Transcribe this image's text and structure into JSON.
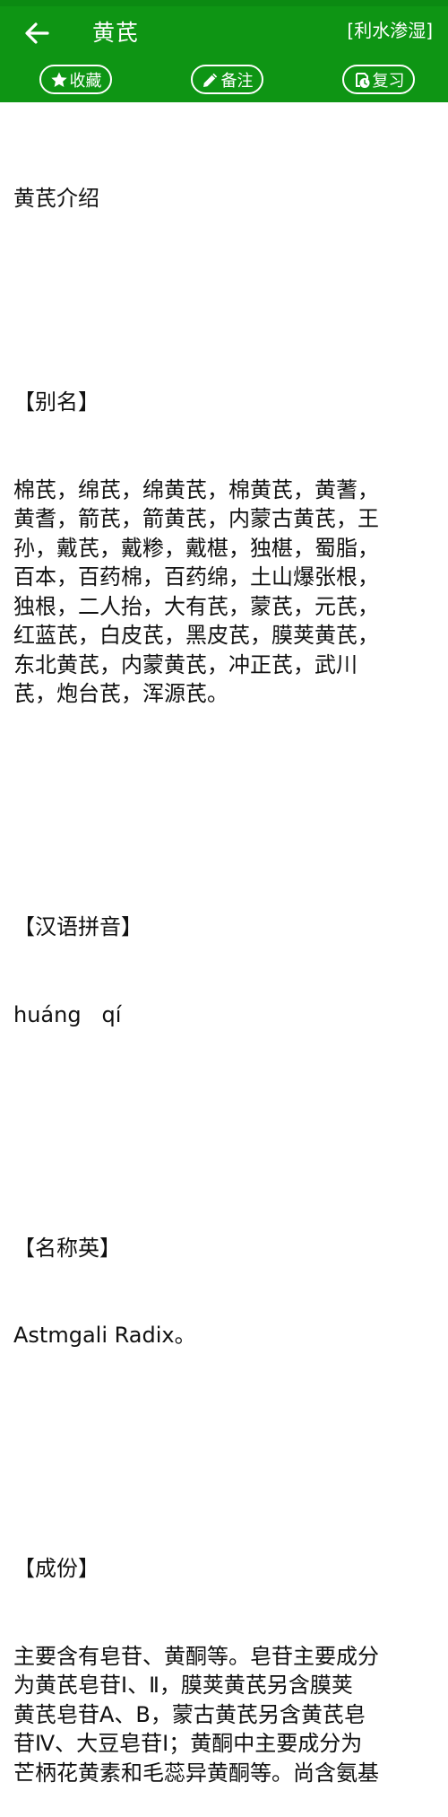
{
  "appbar": {
    "title": "黄芪",
    "category": "[利水渗湿]",
    "buttons": {
      "favorite": "收藏",
      "note": "备注",
      "review": "复习"
    },
    "icons": {
      "back": "arrow-left-icon",
      "favorite": "star-icon",
      "note": "pencil-icon",
      "review": "review-clock-icon"
    },
    "color": "#0e9514"
  },
  "content": {
    "intro_title": "黄芪介绍",
    "sections": [
      {
        "heading": "【别名】",
        "body": "棉芪，绵芪，绵黄芪，棉黄芪，黄蓍，\n黄耆，箭芪，箭黄芪，内蒙古黄芪，王\n孙，戴芪，戴糁，戴椹，独椹，蜀脂，\n百本，百药棉，百药绵，土山爆张根，\n独根，二人抬，大有芪，蒙芪，元芪，\n红蓝芪，白皮芪，黑皮芪，膜荚黄芪，\n东北黄芪，内蒙黄芪，冲正芪，武川\n芪，炮台芪，浑源芪。"
      },
      {
        "heading": "【汉语拼音】",
        "body": "huáng   qí"
      },
      {
        "heading": "【名称英】",
        "body": "Astmgali Radix。"
      },
      {
        "heading": "【成份】",
        "body": "主要含有皂苷、黄酮等。皂苷主要成分\n为黄芪皂苷Ⅰ、Ⅱ，膜荚黄芪另含膜荚\n黄芪皂苷A、B，蒙古黄芪另含黄芪皂\n苷Ⅳ、大豆皂苷Ⅰ；黄酮中主要成分为\n芒柄花黄素和毛蕊异黄酮等。尚含氨基"
      }
    ]
  }
}
